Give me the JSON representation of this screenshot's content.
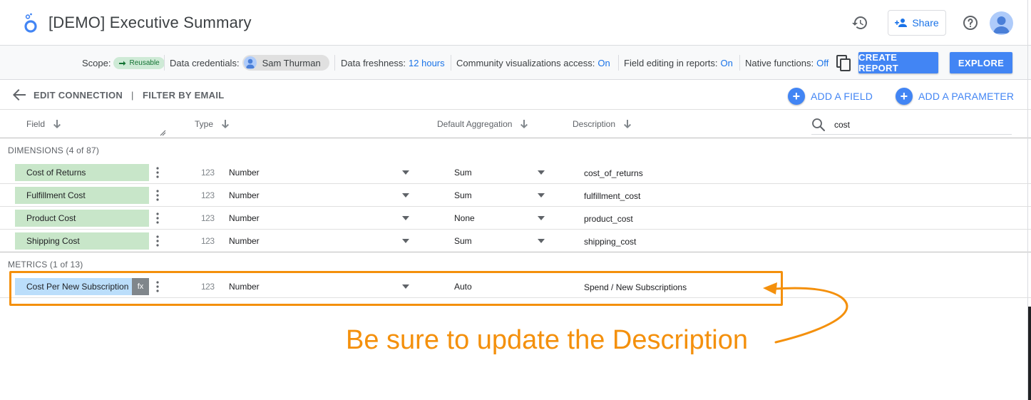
{
  "header": {
    "title": "[DEMO] Executive Summary",
    "share_label": "Share",
    "icons": [
      "looker-studio-logo-icon",
      "history-icon",
      "person-add-icon",
      "help-icon",
      "account-avatar-icon"
    ]
  },
  "toolbar": {
    "scope_label": "Scope:",
    "scope_value": "Reusable",
    "credentials_label": "Data credentials:",
    "credentials_value": "Sam Thurman",
    "freshness_label": "Data freshness:",
    "freshness_value": "12 hours",
    "community_label": "Community visualizations access:",
    "community_value": "On",
    "field_editing_label": "Field editing in reports:",
    "field_editing_value": "On",
    "native_functions_label": "Native functions:",
    "native_functions_value": "Off",
    "create_report_label": "CREATE REPORT",
    "explore_label": "EXPLORE"
  },
  "actionbar": {
    "edit_connection_label": "EDIT CONNECTION",
    "separator": "|",
    "filter_by_email_label": "FILTER BY EMAIL",
    "add_field_label": "ADD A FIELD",
    "add_parameter_label": "ADD A PARAMETER"
  },
  "columns": {
    "field": "Field",
    "type": "Type",
    "default_aggregation": "Default Aggregation",
    "description": "Description"
  },
  "search": {
    "value": "cost",
    "placeholder": ""
  },
  "dimensions": {
    "label": "DIMENSIONS (4 of 87)",
    "rows": [
      {
        "field": "Cost of Returns",
        "type_icon": "123",
        "type": "Number",
        "aggregation": "Sum",
        "description": "cost_of_returns"
      },
      {
        "field": "Fulfillment Cost",
        "type_icon": "123",
        "type": "Number",
        "aggregation": "Sum",
        "description": "fulfillment_cost"
      },
      {
        "field": "Product Cost",
        "type_icon": "123",
        "type": "Number",
        "aggregation": "None",
        "description": "product_cost"
      },
      {
        "field": "Shipping Cost",
        "type_icon": "123",
        "type": "Number",
        "aggregation": "Sum",
        "description": "shipping_cost"
      }
    ]
  },
  "metrics": {
    "label": "METRICS (1 of 13)",
    "rows": [
      {
        "field": "Cost Per New Subscription",
        "badge": "fx",
        "type_icon": "123",
        "type": "Number",
        "aggregation": "Auto",
        "description": "Spend / New Subscriptions"
      }
    ]
  },
  "annotation": {
    "text": "Be sure to update the Description",
    "color": "#f4900c"
  },
  "colors": {
    "accent": "#4285f4",
    "link": "#1a73e8",
    "dimension_chip": "#c8e6c9",
    "metric_chip": "#bbdefb",
    "annotation": "#f4900c"
  }
}
